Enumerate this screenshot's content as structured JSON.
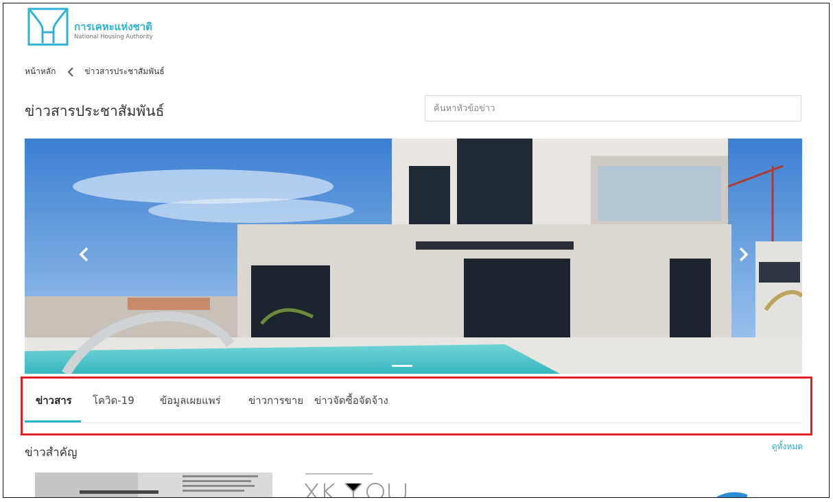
{
  "brand": {
    "name_th": "การเคหะแห่งชาติ",
    "name_en": "National Housing Authority",
    "color": "#2db1d6"
  },
  "breadcrumb": {
    "home": "หน้าหลัก",
    "current": "ข่าวสารประชาสัมพันธ์",
    "separator_icon": "chevron-left-icon"
  },
  "page": {
    "title": "ข่าวสารประชาสัมพันธ์"
  },
  "search": {
    "placeholder": "ค้นหาหัวข้อข่าว",
    "value": ""
  },
  "carousel": {
    "prev_icon": "chevron-left-icon",
    "next_icon": "chevron-right-icon",
    "active_slide": 1
  },
  "tabs": [
    {
      "label": "ข่าวสาร",
      "active": true
    },
    {
      "label": "โควิด-19",
      "active": false
    },
    {
      "label": "ข้อมูลเผยแพร่",
      "active": false
    },
    {
      "label": "ข่าวการขาย",
      "active": false
    },
    {
      "label": "ข่าวจัดซื้อจัดจ้าง",
      "active": false
    }
  ],
  "section": {
    "title": "ข่าวสำคัญ",
    "view_all": "ดูทั้งหมด"
  },
  "colors": {
    "accent": "#22b8c9",
    "highlight_box": "#e21e26"
  }
}
